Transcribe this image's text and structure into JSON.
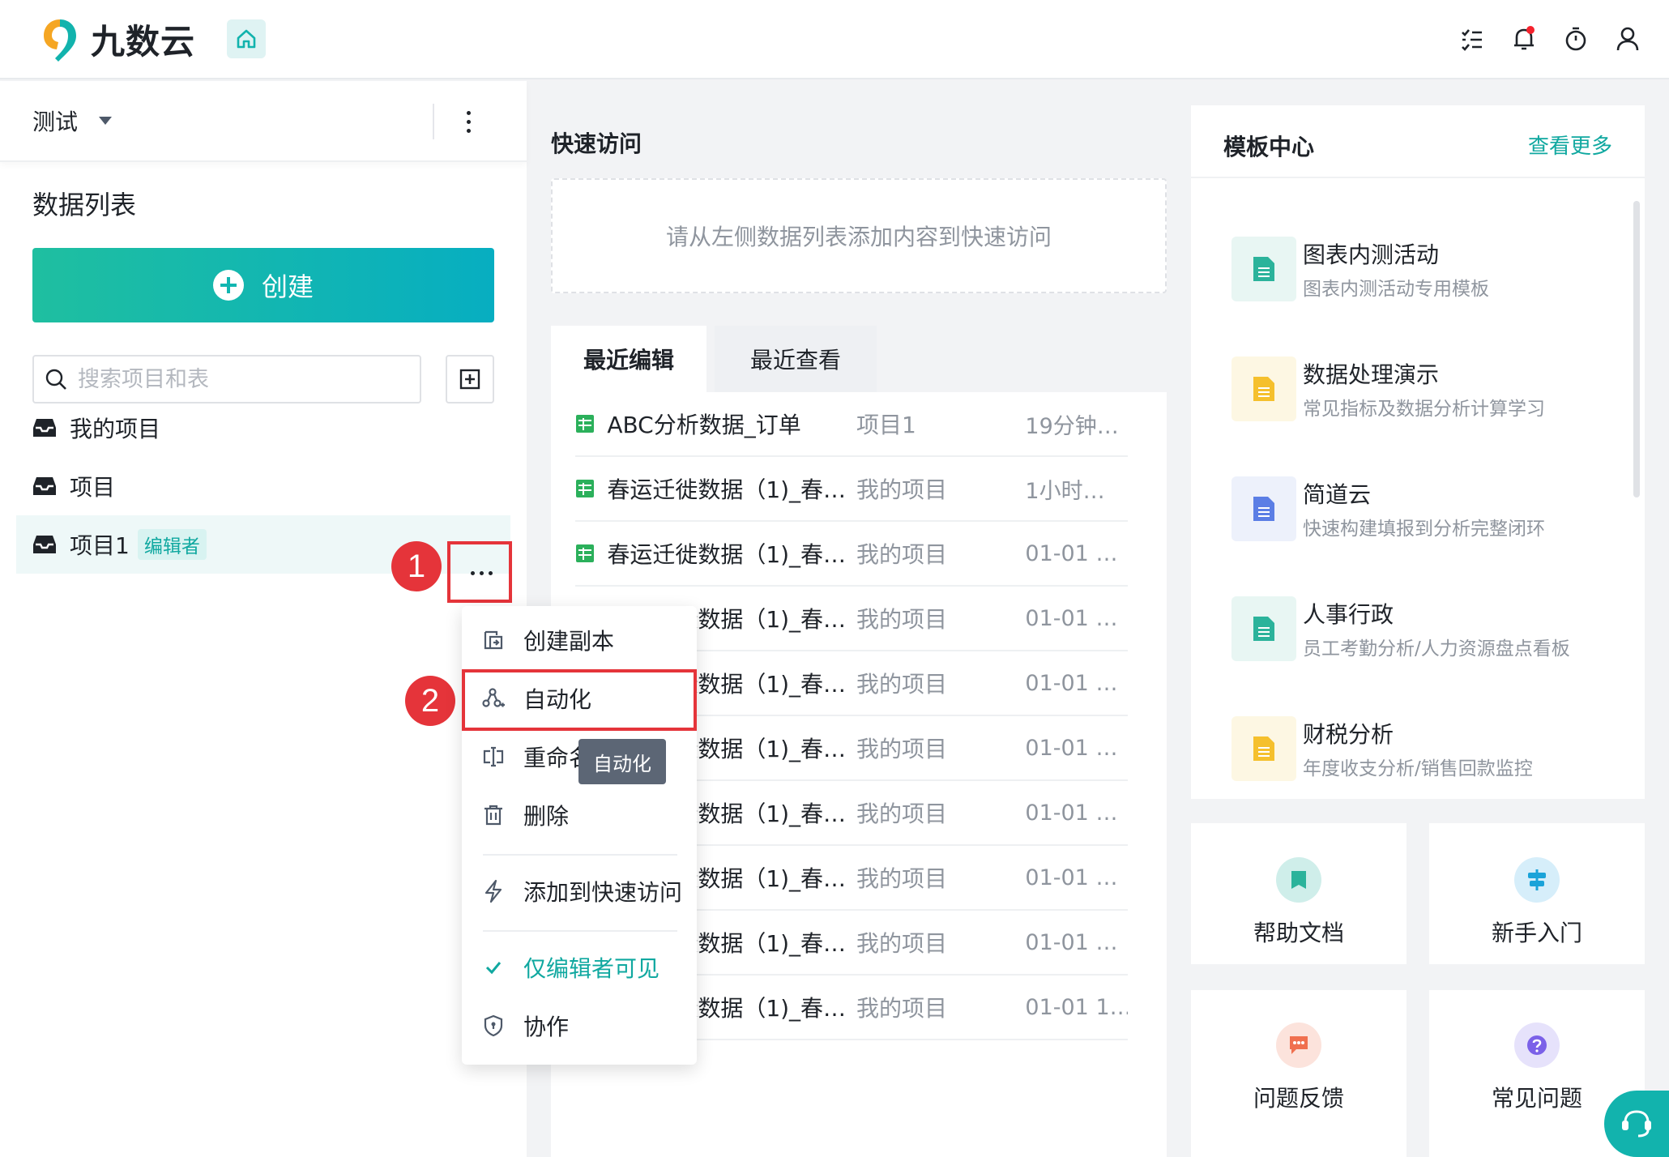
{
  "app": {
    "brand": "九数云",
    "accent_color": "#12b3ad",
    "annotation_color": "#e5343a"
  },
  "header": {
    "icons": [
      "task-list-icon",
      "bell-icon",
      "timer-icon",
      "user-icon"
    ]
  },
  "sidebar": {
    "workspace": "测试",
    "title": "数据列表",
    "create_label": "创建",
    "search_placeholder": "搜索项目和表",
    "projects": [
      {
        "label": "我的项目"
      },
      {
        "label": "项目"
      },
      {
        "label": "项目1",
        "badge": "编辑者"
      }
    ]
  },
  "annotations": {
    "step1": "1",
    "step2": "2"
  },
  "context_menu": {
    "items": [
      {
        "label": "创建副本",
        "icon": "copy-icon"
      },
      {
        "label": "自动化",
        "icon": "automation-icon"
      },
      {
        "label": "重命名",
        "icon": "rename-icon"
      },
      {
        "label": "删除",
        "icon": "trash-icon"
      },
      {
        "label": "添加到快速访问",
        "icon": "lightning-icon"
      },
      {
        "label": "仅编辑者可见",
        "icon": "check-icon",
        "checked": true
      },
      {
        "label": "协作",
        "icon": "shield-icon"
      }
    ],
    "tooltip": "自动化"
  },
  "main": {
    "quick_access_title": "快速访问",
    "quick_access_empty": "请从左侧数据列表添加内容到快速访问",
    "tabs": [
      "最近编辑",
      "最近查看"
    ],
    "rows": [
      {
        "name": "ABC分析数据_订单",
        "project": "项目1",
        "time": "19分钟…"
      },
      {
        "name": "春运迁徙数据（1)_春…",
        "project": "我的项目",
        "time": "1小时…"
      },
      {
        "name": "春运迁徙数据（1)_春…",
        "project": "我的项目",
        "time": "01-01 …"
      },
      {
        "name": "春运迁徙数据（1)_春…",
        "project": "我的项目",
        "time": "01-01 …"
      },
      {
        "name": "春运迁徙数据（1)_春…",
        "project": "我的项目",
        "time": "01-01 …"
      },
      {
        "name": "春运迁徙数据（1)_春…",
        "project": "我的项目",
        "time": "01-01 …"
      },
      {
        "name": "春运迁徙数据（1)_春…",
        "project": "我的项目",
        "time": "01-01 …"
      },
      {
        "name": "春运迁徙数据（1)_春…",
        "project": "我的项目",
        "time": "01-01 …"
      },
      {
        "name": "春运迁徙数据（1)_春…",
        "project": "我的项目",
        "time": "01-01 …"
      },
      {
        "name": "春运迁徙数据（1)_春…",
        "project": "我的项目",
        "time": "01-01 1…"
      }
    ]
  },
  "templates": {
    "title": "模板中心",
    "more": "查看更多",
    "items": [
      {
        "name": "图表内测活动",
        "desc": "图表内测活动专用模板",
        "color": "#2bb39b",
        "bg": "#e8f6f3"
      },
      {
        "name": "数据处理演示",
        "desc": "常见指标及数据分析计算学习",
        "color": "#f5c02d",
        "bg": "#fdf7e3"
      },
      {
        "name": "简道云",
        "desc": "快速构建填报到分析完整闭环",
        "color": "#5b7ee5",
        "bg": "#edf1fb"
      },
      {
        "name": "人事行政",
        "desc": "员工考勤分析/人力资源盘点看板",
        "color": "#2bb39b",
        "bg": "#e8f6f3"
      },
      {
        "name": "财税分析",
        "desc": "年度收支分析/销售回款监控",
        "color": "#f5c02d",
        "bg": "#fdf7e3"
      }
    ]
  },
  "cards": [
    {
      "label": "帮助文档",
      "icon": "help-doc-icon"
    },
    {
      "label": "新手入门",
      "icon": "beginner-icon"
    },
    {
      "label": "问题反馈",
      "icon": "feedback-icon"
    },
    {
      "label": "常见问题",
      "icon": "faq-icon"
    }
  ]
}
